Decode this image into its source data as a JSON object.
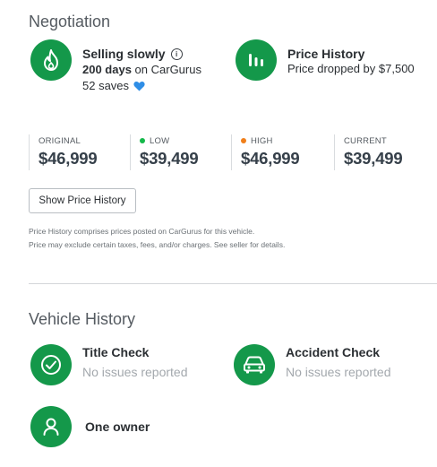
{
  "negotiation": {
    "title": "Negotiation",
    "selling": {
      "title": "Selling slowly",
      "info_icon": "info-icon",
      "days_bold": "200 days",
      "days_rest": " on CarGurus",
      "saves": "52 saves",
      "heart_icon": "heart-icon",
      "icon": "flame-icon"
    },
    "price_history": {
      "title": "Price History",
      "subtitle": "Price dropped by $7,500",
      "icon": "bar-chart-icon"
    },
    "prices": [
      {
        "label": "ORIGINAL",
        "value": "$46,999",
        "dot": ""
      },
      {
        "label": "LOW",
        "value": "$39,499",
        "dot": "#14b84a"
      },
      {
        "label": "HIGH",
        "value": "$46,999",
        "dot": "#f07f1a"
      },
      {
        "label": "CURRENT",
        "value": "$39,499",
        "dot": ""
      }
    ],
    "button_label": "Show Price History",
    "note_line1": "Price History comprises prices posted on CarGurus for this vehicle.",
    "note_line2": "Price may exclude certain taxes, fees, and/or charges. See seller for details."
  },
  "vehicle_history": {
    "title": "Vehicle History",
    "title_check": {
      "title": "Title Check",
      "status": "No issues reported",
      "icon": "check-circle-icon"
    },
    "accident_check": {
      "title": "Accident Check",
      "status": "No issues reported",
      "icon": "car-icon"
    },
    "owners": {
      "title": "One owner",
      "icon": "person-icon"
    }
  },
  "colors": {
    "accent_green": "#14984a",
    "heart_blue": "#2f8ee6"
  }
}
